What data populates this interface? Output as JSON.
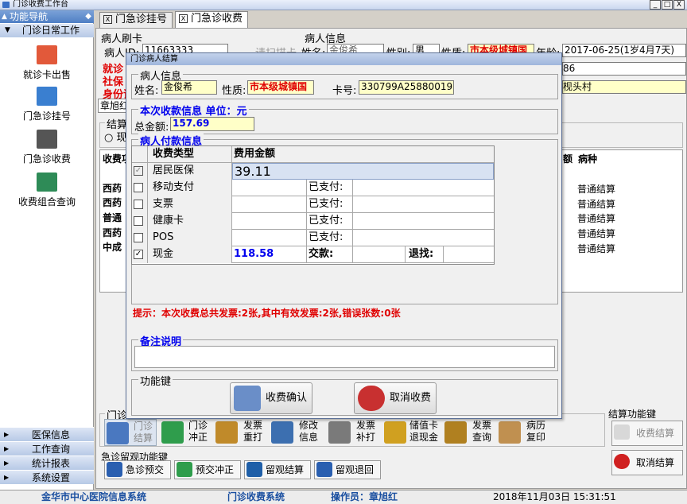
{
  "window": {
    "title": "门诊收费工作台",
    "min": "_",
    "max": "□",
    "close": "X"
  },
  "nav": {
    "header": "功能导航",
    "group": "门诊日常工作",
    "items": [
      {
        "label": "就诊卡出售",
        "icon": "card-sale-icon",
        "color": "#e2593a"
      },
      {
        "label": "门急诊挂号",
        "icon": "register-icon",
        "color": "#3a7fd0"
      },
      {
        "label": "门急诊收费",
        "icon": "cash-register-icon",
        "color": "#555555"
      },
      {
        "label": "收费组合查询",
        "icon": "query-icon",
        "color": "#2e8b57"
      }
    ],
    "bottom": [
      "医保信息",
      "工作查询",
      "统计报表",
      "系统设置"
    ]
  },
  "tabs": [
    {
      "label": "门急诊挂号"
    },
    {
      "label": "门急诊收费"
    }
  ],
  "card": {
    "group": "病人刷卡",
    "id_label": "病人ID:",
    "id_value": "11663333",
    "hint": "请扫描卡",
    "row2": "就诊",
    "row3": "社保",
    "row4": "身份证"
  },
  "patient_bg": {
    "group": "病人信息",
    "name_label": "姓名:",
    "name_value": "金俊希",
    "sex_label": "性别:",
    "sex_value": "男",
    "nature_label": "性质:",
    "nature_value": "市本级城镇国",
    "age_label": "年龄:",
    "age_value": "2017-06-25(1岁4月7天)",
    "phone_suffix": "86",
    "address_suffix": "枧头村"
  },
  "operator_tab": "章旭红",
  "settle_group": "结算",
  "settle_radio": "现",
  "bg_table": {
    "col0": "收费项",
    "col_amount": "额",
    "col_disease": "病种",
    "rows": [
      {
        "item": "西药",
        "disease": "普通结算"
      },
      {
        "item": "西药",
        "disease": "普通结算"
      },
      {
        "item": "普通",
        "disease": "普通结算"
      },
      {
        "item": "西药",
        "disease": "普通结算"
      },
      {
        "item": "中成",
        "disease": "普通结算"
      }
    ]
  },
  "clinic_group": "门诊收",
  "func_buttons": [
    {
      "label1": "门诊",
      "label2": "结算",
      "icon": "settle-icon",
      "color": "#4a78c0",
      "disabled": true
    },
    {
      "label1": "门诊",
      "label2": "冲正",
      "icon": "reverse-icon",
      "color": "#2f9d4c"
    },
    {
      "label1": "发票",
      "label2": "重打",
      "icon": "reprint-icon",
      "color": "#c08a2a"
    },
    {
      "label1": "修改",
      "label2": "信息",
      "icon": "edit-info-icon",
      "color": "#3c6fb0"
    },
    {
      "label1": "发票",
      "label2": "补打",
      "icon": "print-icon",
      "color": "#7a7a7a"
    },
    {
      "label1": "储值卡",
      "label2": "退现金",
      "icon": "refund-icon",
      "color": "#d0a020"
    },
    {
      "label1": "发票",
      "label2": "查询",
      "icon": "search-icon",
      "color": "#b08020"
    },
    {
      "label1": "病历",
      "label2": "复印",
      "icon": "copy-icon",
      "color": "#c09050"
    }
  ],
  "emergency_group": "急诊留观功能键",
  "emergency_buttons": [
    {
      "label": "急诊预交",
      "icon": "prepay-icon",
      "color": "#2a5fb0"
    },
    {
      "label": "预交冲正",
      "icon": "prepay-reverse-icon",
      "color": "#2f9d4c"
    },
    {
      "label": "留观结算",
      "icon": "observe-settle-icon",
      "color": "#1f5fa8"
    },
    {
      "label": "留观退回",
      "icon": "observe-return-icon",
      "color": "#2a5fb0"
    }
  ],
  "settle_keys": {
    "group": "结算功能键",
    "charge": "收费结算",
    "cancel": "取消结算"
  },
  "status": {
    "hospital": "金华市中心医院信息系统",
    "system": "门诊收费系统",
    "operator": "操作员：章旭红",
    "datetime": "2018年11月03日  15:31:51"
  },
  "dialog": {
    "title": "门诊病人结算",
    "patient_group": "病人信息",
    "name_label": "姓名:",
    "name_value": "金俊希",
    "nature_label": "性质:",
    "nature_value": "市本级城镇国",
    "card_label": "卡号:",
    "card_value": "330799A25880019",
    "charge_group": "本次收款信息   单位：元",
    "total_label": "总金额:",
    "total_value": "157.69",
    "pay_group": "病人付款信息",
    "pay_headers": [
      "收费类型",
      "费用金额"
    ],
    "pay_rows": [
      {
        "type": "居民医保",
        "amount": "39.11",
        "checked": true,
        "disabled": true
      },
      {
        "type": "移动支付",
        "amount": "",
        "paid_label": "已支付:",
        "checked": false
      },
      {
        "type": "支票",
        "amount": "",
        "paid_label": "已支付:",
        "checked": false
      },
      {
        "type": "健康卡",
        "amount": "",
        "paid_label": "已支付:",
        "checked": false
      },
      {
        "type": "POS",
        "amount": "",
        "paid_label": "已支付:",
        "checked": false
      },
      {
        "type": "现金",
        "amount": "118.58",
        "paid_label": "交款:",
        "change_label": "退找:",
        "checked": true
      }
    ],
    "tip": "提示：本次收费总共发票:2张,其中有效发票:2张,错误张数:0张",
    "remark_group": "备注说明",
    "func_group": "功能键",
    "confirm": "收费确认",
    "cancel": "取消收费"
  }
}
